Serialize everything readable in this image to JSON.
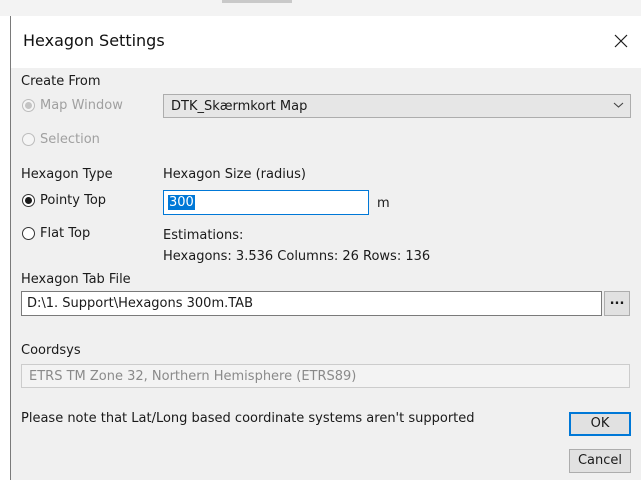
{
  "dialog": {
    "title": "Hexagon Settings"
  },
  "create_from": {
    "label": "Create From",
    "options": [
      {
        "label": "Map Window",
        "checked": true,
        "disabled": true
      },
      {
        "label": "Selection",
        "checked": false,
        "disabled": true
      }
    ],
    "map_select": {
      "value": "DTK_Skærmkort Map"
    }
  },
  "hexagon_type": {
    "label": "Hexagon Type",
    "options": [
      {
        "label": "Pointy Top",
        "checked": true
      },
      {
        "label": "Flat Top",
        "checked": false
      }
    ]
  },
  "hexagon_size": {
    "label": "Hexagon Size (radius)",
    "value": "300",
    "unit": "m"
  },
  "estimations": {
    "label": "Estimations:",
    "text": "Hexagons: 3.536 Columns: 26 Rows: 136"
  },
  "tab_file": {
    "label": "Hexagon Tab File",
    "value": "D:\\1. Support\\Hexagons 300m.TAB",
    "browse_label": "..."
  },
  "coordsys": {
    "label": "Coordsys",
    "value": "ETRS TM Zone 32, Northern Hemisphere (ETRS89)"
  },
  "note": "Please note that Lat/Long based coordinate systems aren't supported",
  "buttons": {
    "ok": "OK",
    "cancel": "Cancel"
  },
  "colors": {
    "accent": "#0078d7",
    "dialog_bg": "#f0f0f0"
  }
}
